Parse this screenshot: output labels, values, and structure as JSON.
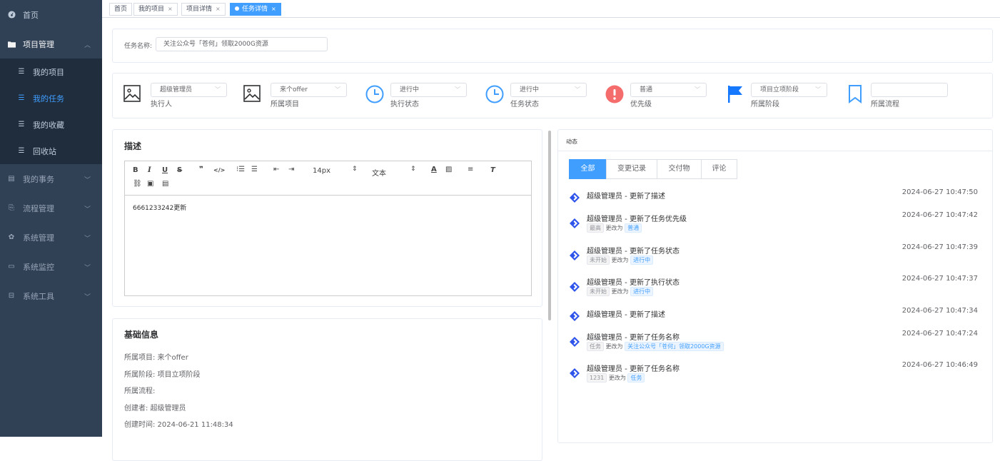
{
  "sidebar": {
    "items": [
      {
        "label": "首页",
        "icon": "dashboard-icon"
      },
      {
        "label": "项目管理",
        "icon": "folder-icon"
      },
      {
        "label": "我的项目",
        "icon": "list-icon"
      },
      {
        "label": "我的任务",
        "icon": "list-icon"
      },
      {
        "label": "我的收藏",
        "icon": "list-icon"
      },
      {
        "label": "回收站",
        "icon": "list-icon"
      },
      {
        "label": "我的事务",
        "icon": "document-icon"
      },
      {
        "label": "流程管理",
        "icon": "flow-icon"
      },
      {
        "label": "系统管理",
        "icon": "gear-icon"
      },
      {
        "label": "系统监控",
        "icon": "monitor-icon"
      },
      {
        "label": "系统工具",
        "icon": "tool-icon"
      }
    ],
    "active_color": "#409eff",
    "bg_color": "#304156"
  },
  "tabs": [
    {
      "label": "首页"
    },
    {
      "label": "我的项目",
      "close": "×"
    },
    {
      "label": "项目详情",
      "close": "×"
    },
    {
      "label": "任务详情",
      "close": "×",
      "active": true
    }
  ],
  "task_name": {
    "label": "任务名称:",
    "value": "关注公众号「苍何」领取2000G资源"
  },
  "fields": [
    {
      "value": "超级管理员",
      "label": "执行人",
      "icon": "image-icon"
    },
    {
      "value": "来个offer",
      "label": "所属项目",
      "icon": "image-icon"
    },
    {
      "value": "进行中",
      "label": "执行状态",
      "icon": "clock-icon"
    },
    {
      "value": "进行中",
      "label": "任务状态",
      "icon": "clock-icon"
    },
    {
      "value": "普通",
      "label": "优先级",
      "icon": "warning-icon"
    },
    {
      "value": "项目立项阶段",
      "label": "所属阶段",
      "icon": "flag-icon"
    },
    {
      "value": "",
      "label": "所属流程",
      "icon": "bookmark-icon"
    }
  ],
  "description": {
    "title": "描述",
    "toolbar": {
      "font_size": "14px",
      "format": "文本"
    },
    "content": "6661233242更新"
  },
  "basic_info": {
    "title": "基础信息",
    "rows": [
      {
        "text": "所属项目:  来个offer"
      },
      {
        "text": "所属阶段:  项目立项阶段"
      },
      {
        "text": "所属流程:"
      },
      {
        "text": "创建者:  超级管理员"
      },
      {
        "text": "创建时间:  2024-06-21 11:48:34"
      }
    ]
  },
  "activity": {
    "title": "动态",
    "tabs": [
      "全部",
      "变更记录",
      "交付物",
      "评论"
    ],
    "items": [
      {
        "text": "超级管理员 - 更新了描述",
        "time": "2024-06-27 10:47:50"
      },
      {
        "text": "超级管理员 - 更新了任务优先级",
        "time": "2024-06-27 10:47:42",
        "from": "最高",
        "to": "普通",
        "change": "更改为"
      },
      {
        "text": "超级管理员 - 更新了任务状态",
        "time": "2024-06-27 10:47:39",
        "from": "未开始",
        "to": "进行中",
        "change": "更改为"
      },
      {
        "text": "超级管理员 - 更新了执行状态",
        "time": "2024-06-27 10:47:37",
        "from": "未开始",
        "to": "进行中",
        "change": "更改为"
      },
      {
        "text": "超级管理员 - 更新了描述",
        "time": "2024-06-27 10:47:34"
      },
      {
        "text": "超级管理员 - 更新了任务名称",
        "time": "2024-06-27 10:47:24",
        "from": "任务",
        "to": "关注公众号「苍何」领取2000G资源",
        "change": "更改为"
      },
      {
        "text": "超级管理员 - 更新了任务名称",
        "time": "2024-06-27 10:46:49",
        "from": "1231",
        "to": "任务",
        "change": "更改为"
      }
    ]
  }
}
